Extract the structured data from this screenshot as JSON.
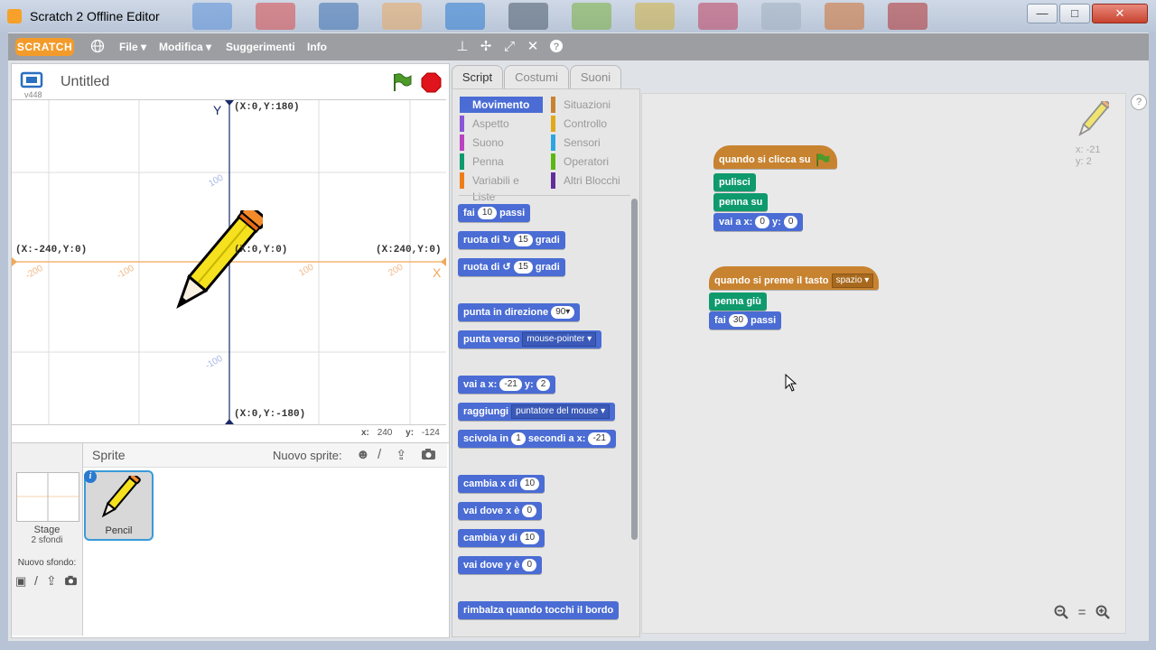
{
  "window": {
    "title": "Scratch 2 Offline Editor",
    "minimize": "—",
    "maximize": "□",
    "close": "✕"
  },
  "menubar": {
    "logo": "SCRATCH",
    "items": [
      "File ▾",
      "Modifica ▾",
      "Suggerimenti",
      "Info"
    ],
    "tools": [
      "duplicate-icon",
      "cut-icon",
      "grow-icon",
      "shrink-icon",
      "help-icon"
    ]
  },
  "stage": {
    "project_name": "Untitled",
    "version": "v448",
    "labels": {
      "y_axis": "Y",
      "x_axis": "X",
      "top": "(X:0,Y:180)",
      "bottom": "(X:0,Y:-180)",
      "left": "(X:-240,Y:0)",
      "right": "(X:240,Y:0)",
      "center": "(X:0,Y:0)"
    },
    "ticks": {
      "x_neg200": "-200",
      "x_neg100": "-100",
      "x_100": "100",
      "x_200": "200",
      "y_100": "100",
      "y_neg100": "-100"
    },
    "mouse_x_label": "x:",
    "mouse_x": "240",
    "mouse_y_label": "y:",
    "mouse_y": "-124"
  },
  "sprites": {
    "header": "Sprite",
    "new_sprite": "Nuovo sprite:",
    "stage_label": "Stage",
    "stage_backdrops": "2 sfondi",
    "new_backdrop": "Nuovo sfondo:",
    "items": [
      {
        "name": "Pencil"
      }
    ]
  },
  "tabs": [
    "Script",
    "Costumi",
    "Suoni"
  ],
  "categories": {
    "left": [
      {
        "label": "Movimento",
        "color": "#4a6cd4",
        "active": true
      },
      {
        "label": "Aspetto",
        "color": "#8a55d7"
      },
      {
        "label": "Suono",
        "color": "#bb42c3"
      },
      {
        "label": "Penna",
        "color": "#0e9a6c"
      },
      {
        "label": "Variabili e Liste",
        "color": "#ee7d16"
      }
    ],
    "right": [
      {
        "label": "Situazioni",
        "color": "#c88330"
      },
      {
        "label": "Controllo",
        "color": "#e1a91a"
      },
      {
        "label": "Sensori",
        "color": "#2ca5e2"
      },
      {
        "label": "Operatori",
        "color": "#5cb712"
      },
      {
        "label": "Altri Blocchi",
        "color": "#632d99"
      }
    ]
  },
  "palette": {
    "b1": {
      "a": "fai",
      "n": "10",
      "b": "passi"
    },
    "b2": {
      "a": "ruota di",
      "n": "15",
      "b": "gradi"
    },
    "b3": {
      "a": "ruota di",
      "n": "15",
      "b": "gradi"
    },
    "b4": {
      "a": "punta in direzione",
      "n": "90▾"
    },
    "b5": {
      "a": "punta verso",
      "d": "mouse-pointer ▾"
    },
    "b6": {
      "a": "vai a x:",
      "n": "-21",
      "b": "y:",
      "n2": "2"
    },
    "b7": {
      "a": "raggiungi",
      "d": "puntatore del mouse ▾"
    },
    "b8": {
      "a": "scivola in",
      "n": "1",
      "b": "secondi a x:",
      "n2": "-21"
    },
    "b9": {
      "a": "cambia x di",
      "n": "10"
    },
    "b10": {
      "a": "vai dove x è",
      "n": "0"
    },
    "b11": {
      "a": "cambia y di",
      "n": "10"
    },
    "b12": {
      "a": "vai dove y è",
      "n": "0"
    },
    "b13": {
      "a": "rimbalza quando tocchi il bordo"
    }
  },
  "script1": {
    "hat": "quando si clicca su",
    "clear": "pulisci",
    "penup": "penna su",
    "goto": {
      "a": "vai a x:",
      "x": "0",
      "b": "y:",
      "y": "0"
    }
  },
  "script2": {
    "hat": "quando si preme il tasto",
    "key": "spazio ▾",
    "pendown": "penna giù",
    "move": {
      "a": "fai",
      "n": "30",
      "b": "passi"
    }
  },
  "sprite_info": {
    "x": "x: -21",
    "y": "y: 2"
  },
  "zoom": {
    "out": "−",
    "reset": "=",
    "in": "+"
  }
}
